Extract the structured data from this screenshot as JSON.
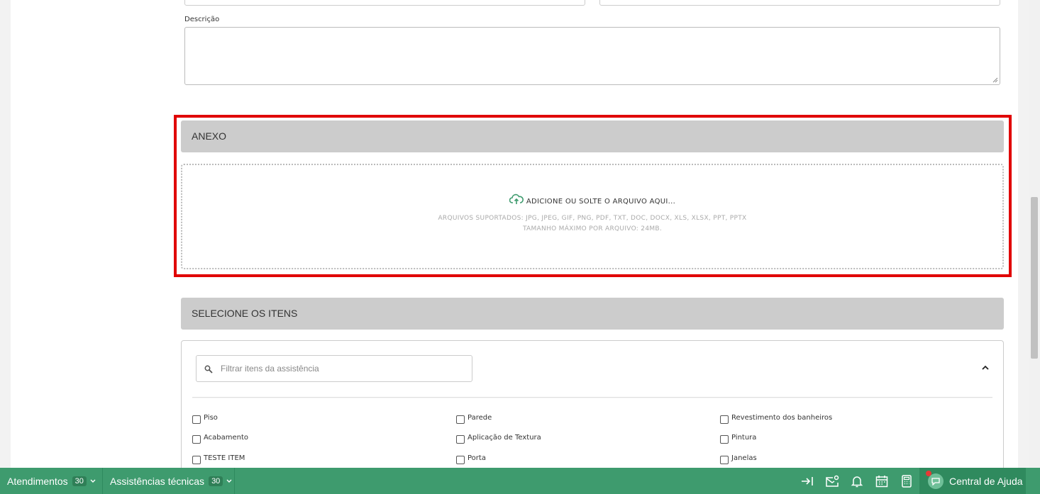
{
  "form": {
    "description_label": "Descrição",
    "description_value": ""
  },
  "attachment": {
    "header": "ANEXO",
    "drop_text": "ADICIONE OU SOLTE O ARQUIVO AQUI...",
    "supported": "ARQUIVOS SUPORTADOS: JPG, JPEG, GIF, PNG, PDF, TXT, DOC, DOCX, XLS, XLSX, PPT, PPTX",
    "max_size": "TAMANHO MÁXIMO POR ARQUIVO: 24MB.",
    "highlight_color": "#e00000",
    "upload_icon": "cloud-upload-icon"
  },
  "items": {
    "header": "SELECIONE OS ITENS",
    "filter_placeholder": "Filtrar itens da assistência",
    "list": [
      {
        "label": "Piso",
        "checked": false
      },
      {
        "label": "Parede",
        "checked": false
      },
      {
        "label": "Revestimento dos banheiros",
        "checked": false
      },
      {
        "label": "Acabamento",
        "checked": false
      },
      {
        "label": "Aplicação de Textura",
        "checked": false
      },
      {
        "label": "Pintura",
        "checked": false
      },
      {
        "label": "TESTE ITEM",
        "checked": false
      },
      {
        "label": "Porta",
        "checked": false
      },
      {
        "label": "Janelas",
        "checked": false
      }
    ]
  },
  "bottom_bar": {
    "background": "#3e9b6e",
    "tabs": [
      {
        "label": "Atendimentos",
        "count": "30"
      },
      {
        "label": "Assistências técnicas",
        "count": "30"
      }
    ],
    "icons": [
      "arrow-to-right-icon",
      "mail-settings-icon",
      "bell-icon",
      "calendar-icon",
      "calculator-icon"
    ],
    "help_label": "Central de Ajuda"
  }
}
